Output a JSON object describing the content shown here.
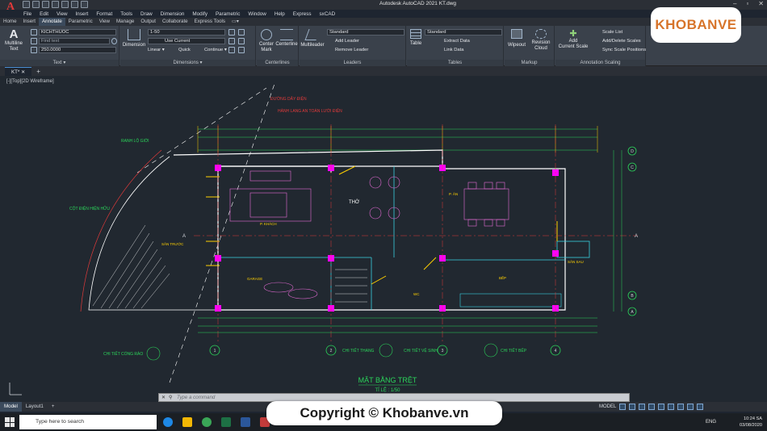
{
  "window": {
    "title": "Autodesk AutoCAD 2021    KT.dwg",
    "logo_letter": "A"
  },
  "menu": [
    "File",
    "Edit",
    "View",
    "Insert",
    "Format",
    "Tools",
    "Draw",
    "Dimension",
    "Modify",
    "Parametric",
    "Window",
    "Help",
    "Express",
    "sxCAD"
  ],
  "ribbon_tabs": [
    {
      "label": "Home"
    },
    {
      "label": "Insert"
    },
    {
      "label": "Annotate",
      "active": true
    },
    {
      "label": "Parametric"
    },
    {
      "label": "View"
    },
    {
      "label": "Manage"
    },
    {
      "label": "Output"
    },
    {
      "label": "Collaborate"
    },
    {
      "label": "Express Tools"
    },
    {
      "label": "▭▾"
    }
  ],
  "ribbon": {
    "text_panel": {
      "title": "Text ▾",
      "multiline": "Multiline",
      "multiline2": "Text",
      "style": "KICHTHUOC",
      "find": "Find text",
      "height": "250.0000"
    },
    "dimensions_panel": {
      "title": "Dimensions ▾",
      "button": "Dimension",
      "style": "1-50",
      "layer": "Use Current",
      "linear": "Linear ▾",
      "quick": "Quick",
      "continue": "Continue ▾"
    },
    "centerlines_panel": {
      "title": "Centerlines",
      "center_mark": "Center",
      "center_mark2": "Mark",
      "centerline": "Centerline"
    },
    "leaders_panel": {
      "title": "Leaders",
      "button": "Multileader",
      "style": "Standard",
      "add": "Add Leader",
      "remove": "Remove Leader"
    },
    "tables_panel": {
      "title": "Tables",
      "button": "Table",
      "style": "Standard",
      "extract": "Extract Data",
      "link": "Link Data"
    },
    "markup_panel": {
      "title": "Markup",
      "wipeout": "Wipeout",
      "revision": "Revision",
      "revision2": "Cloud"
    },
    "annotation_scaling_panel": {
      "title": "Annotation Scaling",
      "add": "Add",
      "add2": "Current Scale",
      "scale_list": "Scale List",
      "add_delete": "Add/Delete Scales",
      "sync": "Sync Scale Positions"
    }
  },
  "brand_logo": "KHOBANVE",
  "file_tabs": [
    {
      "label": "KT*"
    }
  ],
  "drawing": {
    "title": "MẶT BẰNG TRỆT",
    "scale": "TỈ LỆ : 1/50",
    "labels": {
      "duong_day": "ĐƯỜNG DÂY ĐIỆN",
      "hanh_lang": "HÀNH LANG AN TOÀN LƯỚI ĐIỆN",
      "ranh_lo_gioi": "RANH LỘ GIỚI",
      "cot_dien": "CỘT ĐIỆN HIỆN HỮU",
      "chi_tiet_cong": "CHI TIẾT CỔNG RÀO",
      "chi_tiet_thang": "CHI TIẾT THANG",
      "chi_tiet_ve_sinh": "CHI TIẾT VỆ SINH",
      "chi_tiet_bep": "CHI TIẾT BẾP",
      "p_khach": "P. KHÁCH",
      "garage": "GARAGE",
      "bep": "BẾP",
      "p_an": "P. ĂN",
      "san_truoc": "SÂN TRƯỚC",
      "san_sau": "SÂN SAU",
      "ve_sinh": "WC",
      "tho": "THỜ",
      "section_a": "A",
      "grid_1": "1",
      "grid_2": "2",
      "grid_3": "3",
      "grid_4": "4",
      "grid_5": "5",
      "grid_A": "A",
      "grid_B": "B",
      "grid_C": "C",
      "grid_D": "D"
    }
  },
  "command_placeholder": "Type a command",
  "layout_tabs": [
    {
      "label": "Model",
      "active": true
    },
    {
      "label": "Layout1"
    },
    {
      "label": "+"
    }
  ],
  "status": {
    "model": "MODEL"
  },
  "copyright": "Copyright © Khobanve.vn",
  "taskbar": {
    "search": "Type here to search",
    "lang": "ENG",
    "time": "10:24 SA",
    "date": "03/08/2020"
  },
  "colors": {
    "accent": "#4a8fd4",
    "autocad_red": "#e03a3a",
    "brand_orange": "#d7742a"
  }
}
